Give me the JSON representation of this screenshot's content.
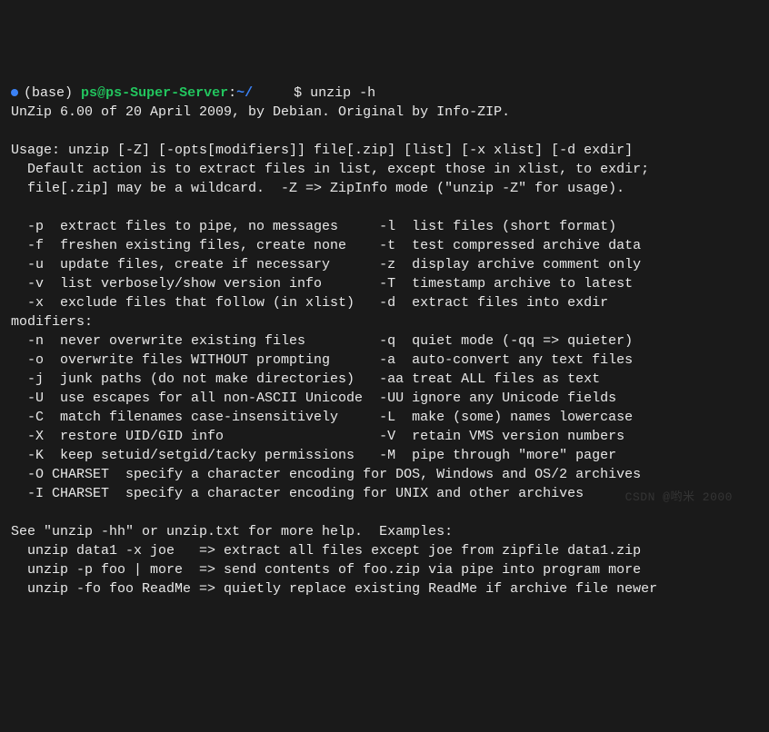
{
  "prompt": {
    "env": "(base)",
    "user": "ps",
    "at": "@",
    "host": "ps-Super-Server",
    "colon": ":",
    "path": "~/",
    "extra": "     ",
    "dollar": "$ ",
    "command": "unzip -h"
  },
  "output": [
    "UnZip 6.00 of 20 April 2009, by Debian. Original by Info-ZIP.",
    "",
    "Usage: unzip [-Z] [-opts[modifiers]] file[.zip] [list] [-x xlist] [-d exdir]",
    "  Default action is to extract files in list, except those in xlist, to exdir;",
    "  file[.zip] may be a wildcard.  -Z => ZipInfo mode (\"unzip -Z\" for usage).",
    "",
    "  -p  extract files to pipe, no messages     -l  list files (short format)",
    "  -f  freshen existing files, create none    -t  test compressed archive data",
    "  -u  update files, create if necessary      -z  display archive comment only",
    "  -v  list verbosely/show version info       -T  timestamp archive to latest",
    "  -x  exclude files that follow (in xlist)   -d  extract files into exdir",
    "modifiers:",
    "  -n  never overwrite existing files         -q  quiet mode (-qq => quieter)",
    "  -o  overwrite files WITHOUT prompting      -a  auto-convert any text files",
    "  -j  junk paths (do not make directories)   -aa treat ALL files as text",
    "  -U  use escapes for all non-ASCII Unicode  -UU ignore any Unicode fields",
    "  -C  match filenames case-insensitively     -L  make (some) names lowercase",
    "  -X  restore UID/GID info                   -V  retain VMS version numbers",
    "  -K  keep setuid/setgid/tacky permissions   -M  pipe through \"more\" pager",
    "  -O CHARSET  specify a character encoding for DOS, Windows and OS/2 archives",
    "  -I CHARSET  specify a character encoding for UNIX and other archives",
    "",
    "See \"unzip -hh\" or unzip.txt for more help.  Examples:",
    "  unzip data1 -x joe   => extract all files except joe from zipfile data1.zip",
    "  unzip -p foo | more  => send contents of foo.zip via pipe into program more",
    "  unzip -fo foo ReadMe => quietly replace existing ReadMe if archive file newer"
  ],
  "watermark": "CSDN @哟米 2000"
}
